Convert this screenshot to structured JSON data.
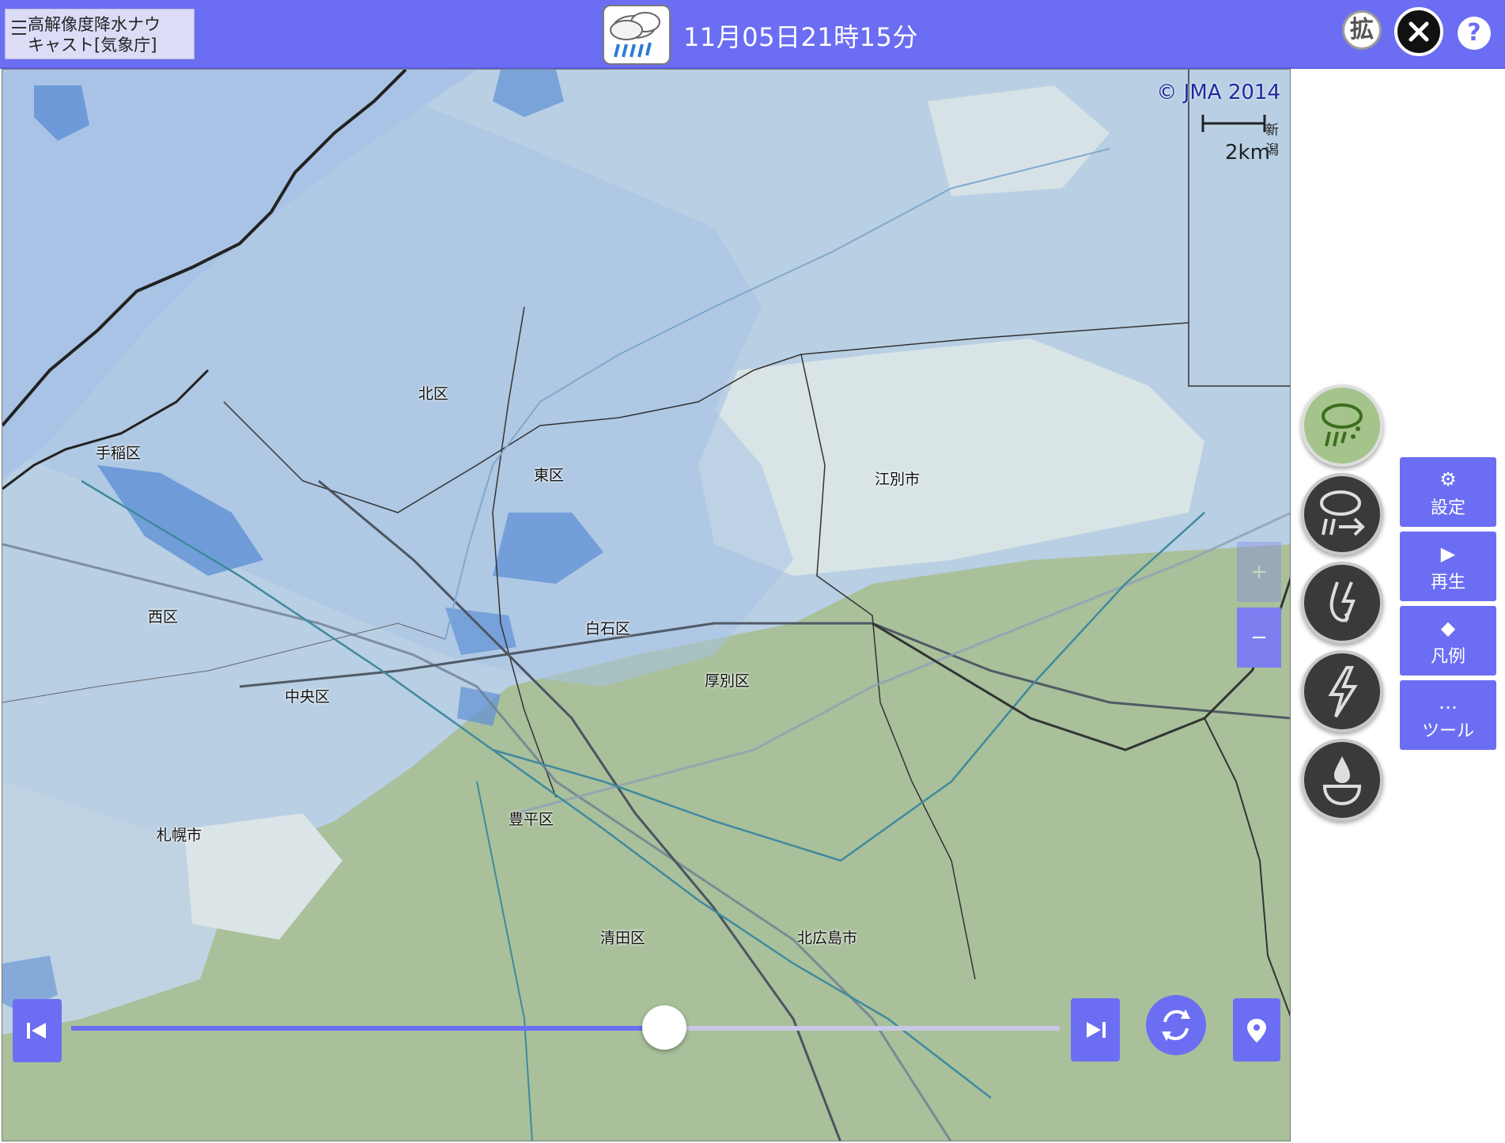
{
  "header": {
    "app_title": "高解像度降水ナウ\nキャスト[気象庁]",
    "datetime": "11月05日21時15分",
    "expand_label": "拡",
    "help_label": "?"
  },
  "map": {
    "copyright": "© JMA 2014",
    "scale_label": "2km",
    "scale_tag": "新潟",
    "labels": {
      "kita": "北区",
      "higashi": "東区",
      "teine": "手稲区",
      "nishi": "西区",
      "chuo": "中央区",
      "shiroishi": "白石区",
      "atsubetsu": "厚別区",
      "ebetsu": "江別市",
      "toyohira": "豊平区",
      "sapporo": "札幌市",
      "kiyota": "清田区",
      "kitahiroshima": "北広島市"
    },
    "zoom_in": "+",
    "zoom_out": "−"
  },
  "timeline": {
    "position": 0.6
  },
  "layers": [
    {
      "name": "rain-cloud",
      "active": true
    },
    {
      "name": "rain-movement",
      "active": false
    },
    {
      "name": "tornado",
      "active": false
    },
    {
      "name": "lightning",
      "active": false
    },
    {
      "name": "water-drop",
      "active": false
    }
  ],
  "side_menu": {
    "settings": "設定",
    "play": "再生",
    "legend": "凡例",
    "tools": "ツール",
    "tools_icon": "…"
  },
  "colors": {
    "accent": "#6b6ef2",
    "rain_light": "#a9c6e8",
    "rain_medium": "#5b8fd8",
    "land": "#a8c09a"
  }
}
